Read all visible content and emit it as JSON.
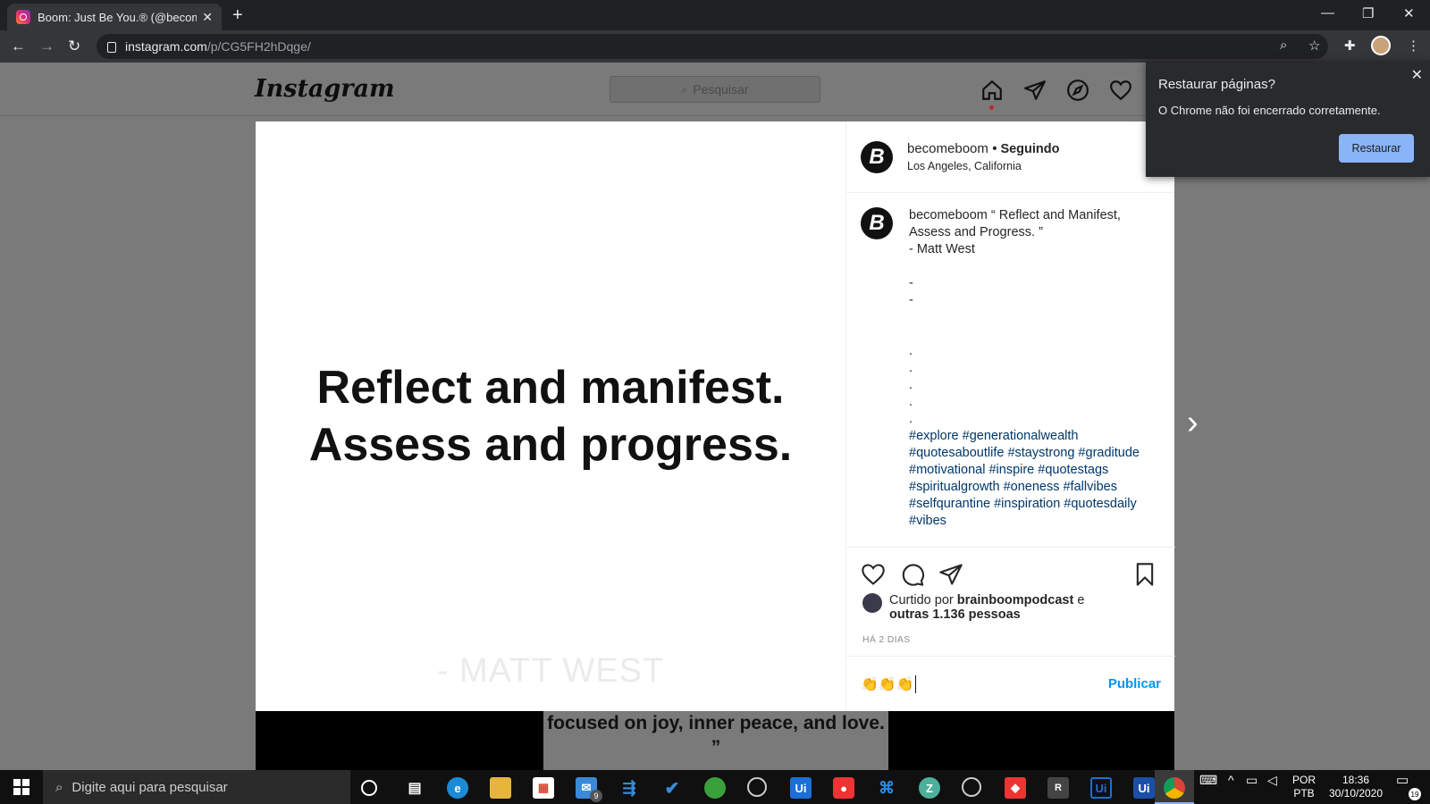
{
  "browser": {
    "tab_title": "Boom: Just Be You.® (@becomeb",
    "tab_close": "✕",
    "new_tab": "+",
    "url_host": "instagram.com",
    "url_path": "/p/CG5FH2hDqge/",
    "win_min": "—",
    "win_restore": "❐",
    "win_close": "✕"
  },
  "instagram": {
    "logo": "Instagram",
    "search_placeholder": "Pesquisar"
  },
  "post": {
    "image_quote_line1": "Reflect and manifest.",
    "image_quote_line2": "Assess and progress.",
    "image_author": "- MATT WEST",
    "account": "becomeboom",
    "following": "• Seguindo",
    "location": "Los Angeles, California",
    "caption_user": "becomeboom",
    "caption_text": "“ Reflect and Manifest, Assess and Progress. ”",
    "caption_author": "- Matt West",
    "hashtags": "#explore #generationalwealth #quotesaboutlife #staystrong #graditude #motivational #inspire #quotestags #spiritualgrowth #oneness #fallvibes #selfqurantine #inspiration #quotesdaily #vibes",
    "liked_prefix": "Curtido por",
    "liked_user": "brainboompodcast",
    "liked_and": "e",
    "liked_others": "outras 1.136 pessoas",
    "time_ago": "HÁ 2 DIAS",
    "comment_value": "👏👏👏",
    "publish_label": "Publicar"
  },
  "background_post": {
    "text": "focused on joy, inner peace, and love. ”"
  },
  "restore_popup": {
    "title": "Restaurar páginas?",
    "message": "O Chrome não foi encerrado corretamente.",
    "button": "Restaurar",
    "close": "✕"
  },
  "taskbar": {
    "search_placeholder": "Digite aqui para pesquisar",
    "lang1": "POR",
    "lang2": "PTB",
    "time": "18:36",
    "date": "30/10/2020",
    "notif_count": "19",
    "mail_badge": "9"
  },
  "colors": {
    "chrome_dark": "#202124",
    "instagram_blue": "#0095f6",
    "hashtag": "#00376b",
    "restore_button": "#8ab4f8"
  }
}
